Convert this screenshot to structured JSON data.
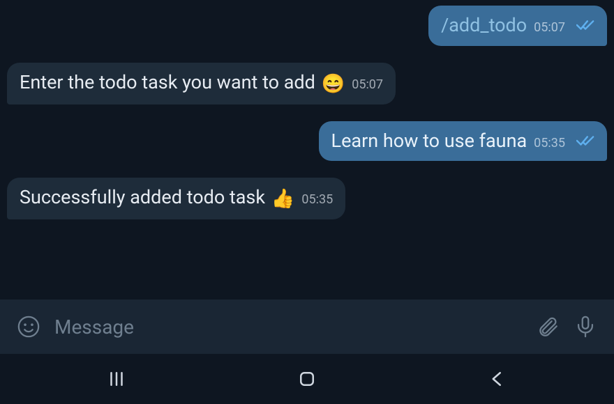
{
  "messages": [
    {
      "side": "out",
      "text": "/add_todo",
      "time": "05:07",
      "read": true,
      "isCommand": true
    },
    {
      "side": "in",
      "text": "Enter the todo task you want to add",
      "emoji": "😄",
      "time": "05:07"
    },
    {
      "side": "out",
      "text": "Learn how to use fauna",
      "time": "05:35",
      "read": true
    },
    {
      "side": "in",
      "text": "Successfully added todo task",
      "emoji": "👍",
      "time": "05:35"
    }
  ],
  "input": {
    "placeholder": "Message"
  },
  "colors": {
    "outgoingBubble": "#3a6d99",
    "incomingBubble": "#1e2c3a",
    "background": "#0e1621",
    "inputBar": "#1a2634",
    "readCheck": "#5fb0ef"
  }
}
